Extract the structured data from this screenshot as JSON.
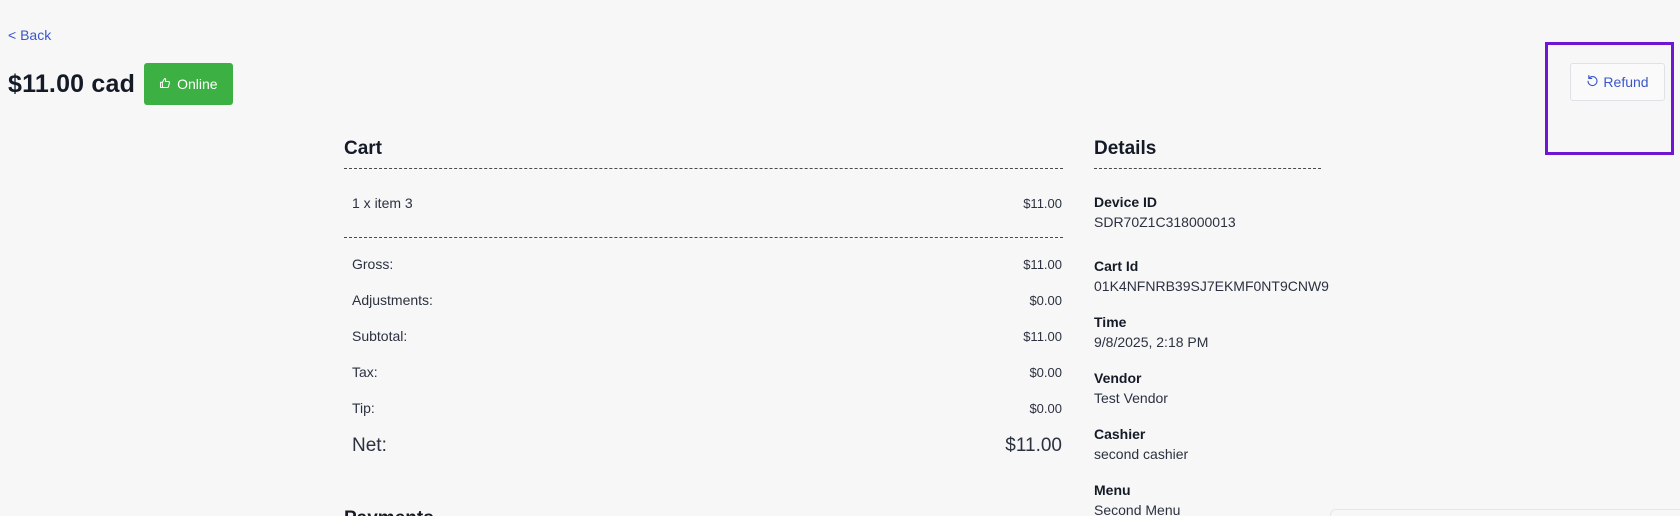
{
  "nav": {
    "back_label": "< Back"
  },
  "header": {
    "amount": "$11.00 cad",
    "status_label": "Online",
    "refund_label": "Refund"
  },
  "cart": {
    "title": "Cart",
    "items": [
      {
        "label": "1 x item 3",
        "value": "$11.00"
      }
    ],
    "totals": {
      "gross_label": "Gross:",
      "gross_value": "$11.00",
      "adjustments_label": "Adjustments:",
      "adjustments_value": "$0.00",
      "subtotal_label": "Subtotal:",
      "subtotal_value": "$11.00",
      "tax_label": "Tax:",
      "tax_value": "$0.00",
      "tip_label": "Tip:",
      "tip_value": "$0.00",
      "net_label": "Net:",
      "net_value": "$11.00"
    }
  },
  "payments": {
    "title": "Payments"
  },
  "details": {
    "title": "Details",
    "device_id_label": "Device ID",
    "device_id_value": "SDR70Z1C318000013",
    "cart_id_label": "Cart Id",
    "cart_id_value": "01K4NFNRB39SJ7EKMF0NT9CNW9",
    "time_label": "Time",
    "time_value": "9/8/2025, 2:18 PM",
    "vendor_label": "Vendor",
    "vendor_value": "Test Vendor",
    "cashier_label": "Cashier",
    "cashier_value": "second cashier",
    "menu_label": "Menu",
    "menu_value": "Second Menu"
  },
  "colors": {
    "accent": "#3b56c9",
    "status_green": "#3cb043",
    "highlight": "#7015d3"
  },
  "icons": {
    "status": "thumbs-up-icon",
    "refund": "undo-icon"
  }
}
